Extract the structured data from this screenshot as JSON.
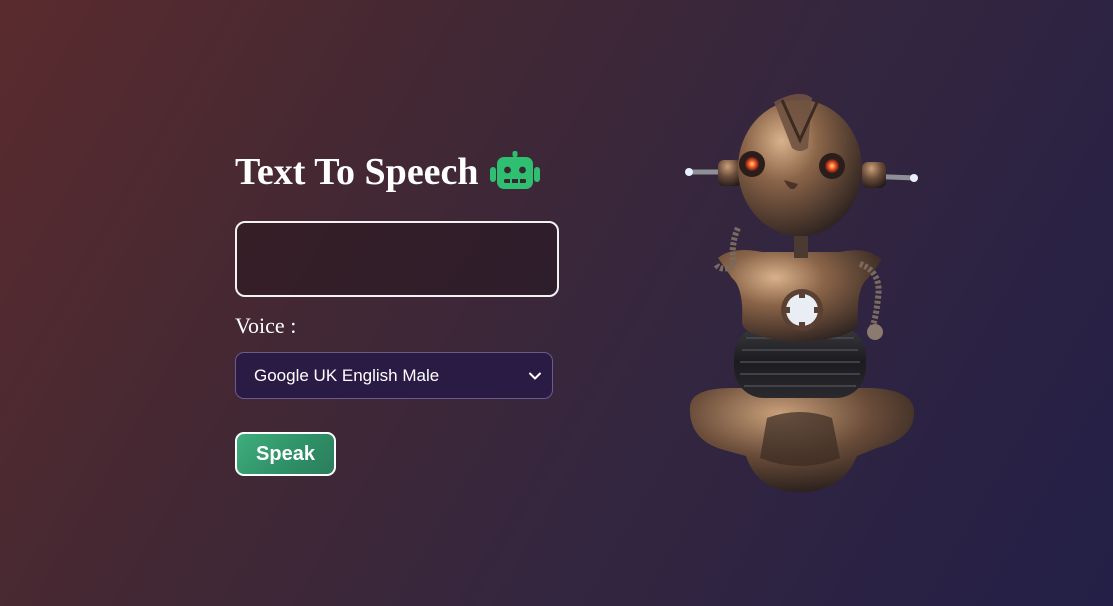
{
  "header": {
    "title": "Text To Speech",
    "title_icon": "robot-icon"
  },
  "input": {
    "value": "",
    "placeholder": ""
  },
  "voice": {
    "label": "Voice :",
    "selected": "Google UK English Male",
    "dropdown_icon": "chevron-down-icon"
  },
  "actions": {
    "speak_label": "Speak"
  },
  "illustration": {
    "icon": "robot-illustration"
  },
  "colors": {
    "accent": "#2fbf71",
    "button": "#3fae7e",
    "select_bg": "#2a1b45",
    "gradient_start": "#5a2b2e",
    "gradient_end": "#231f47"
  }
}
